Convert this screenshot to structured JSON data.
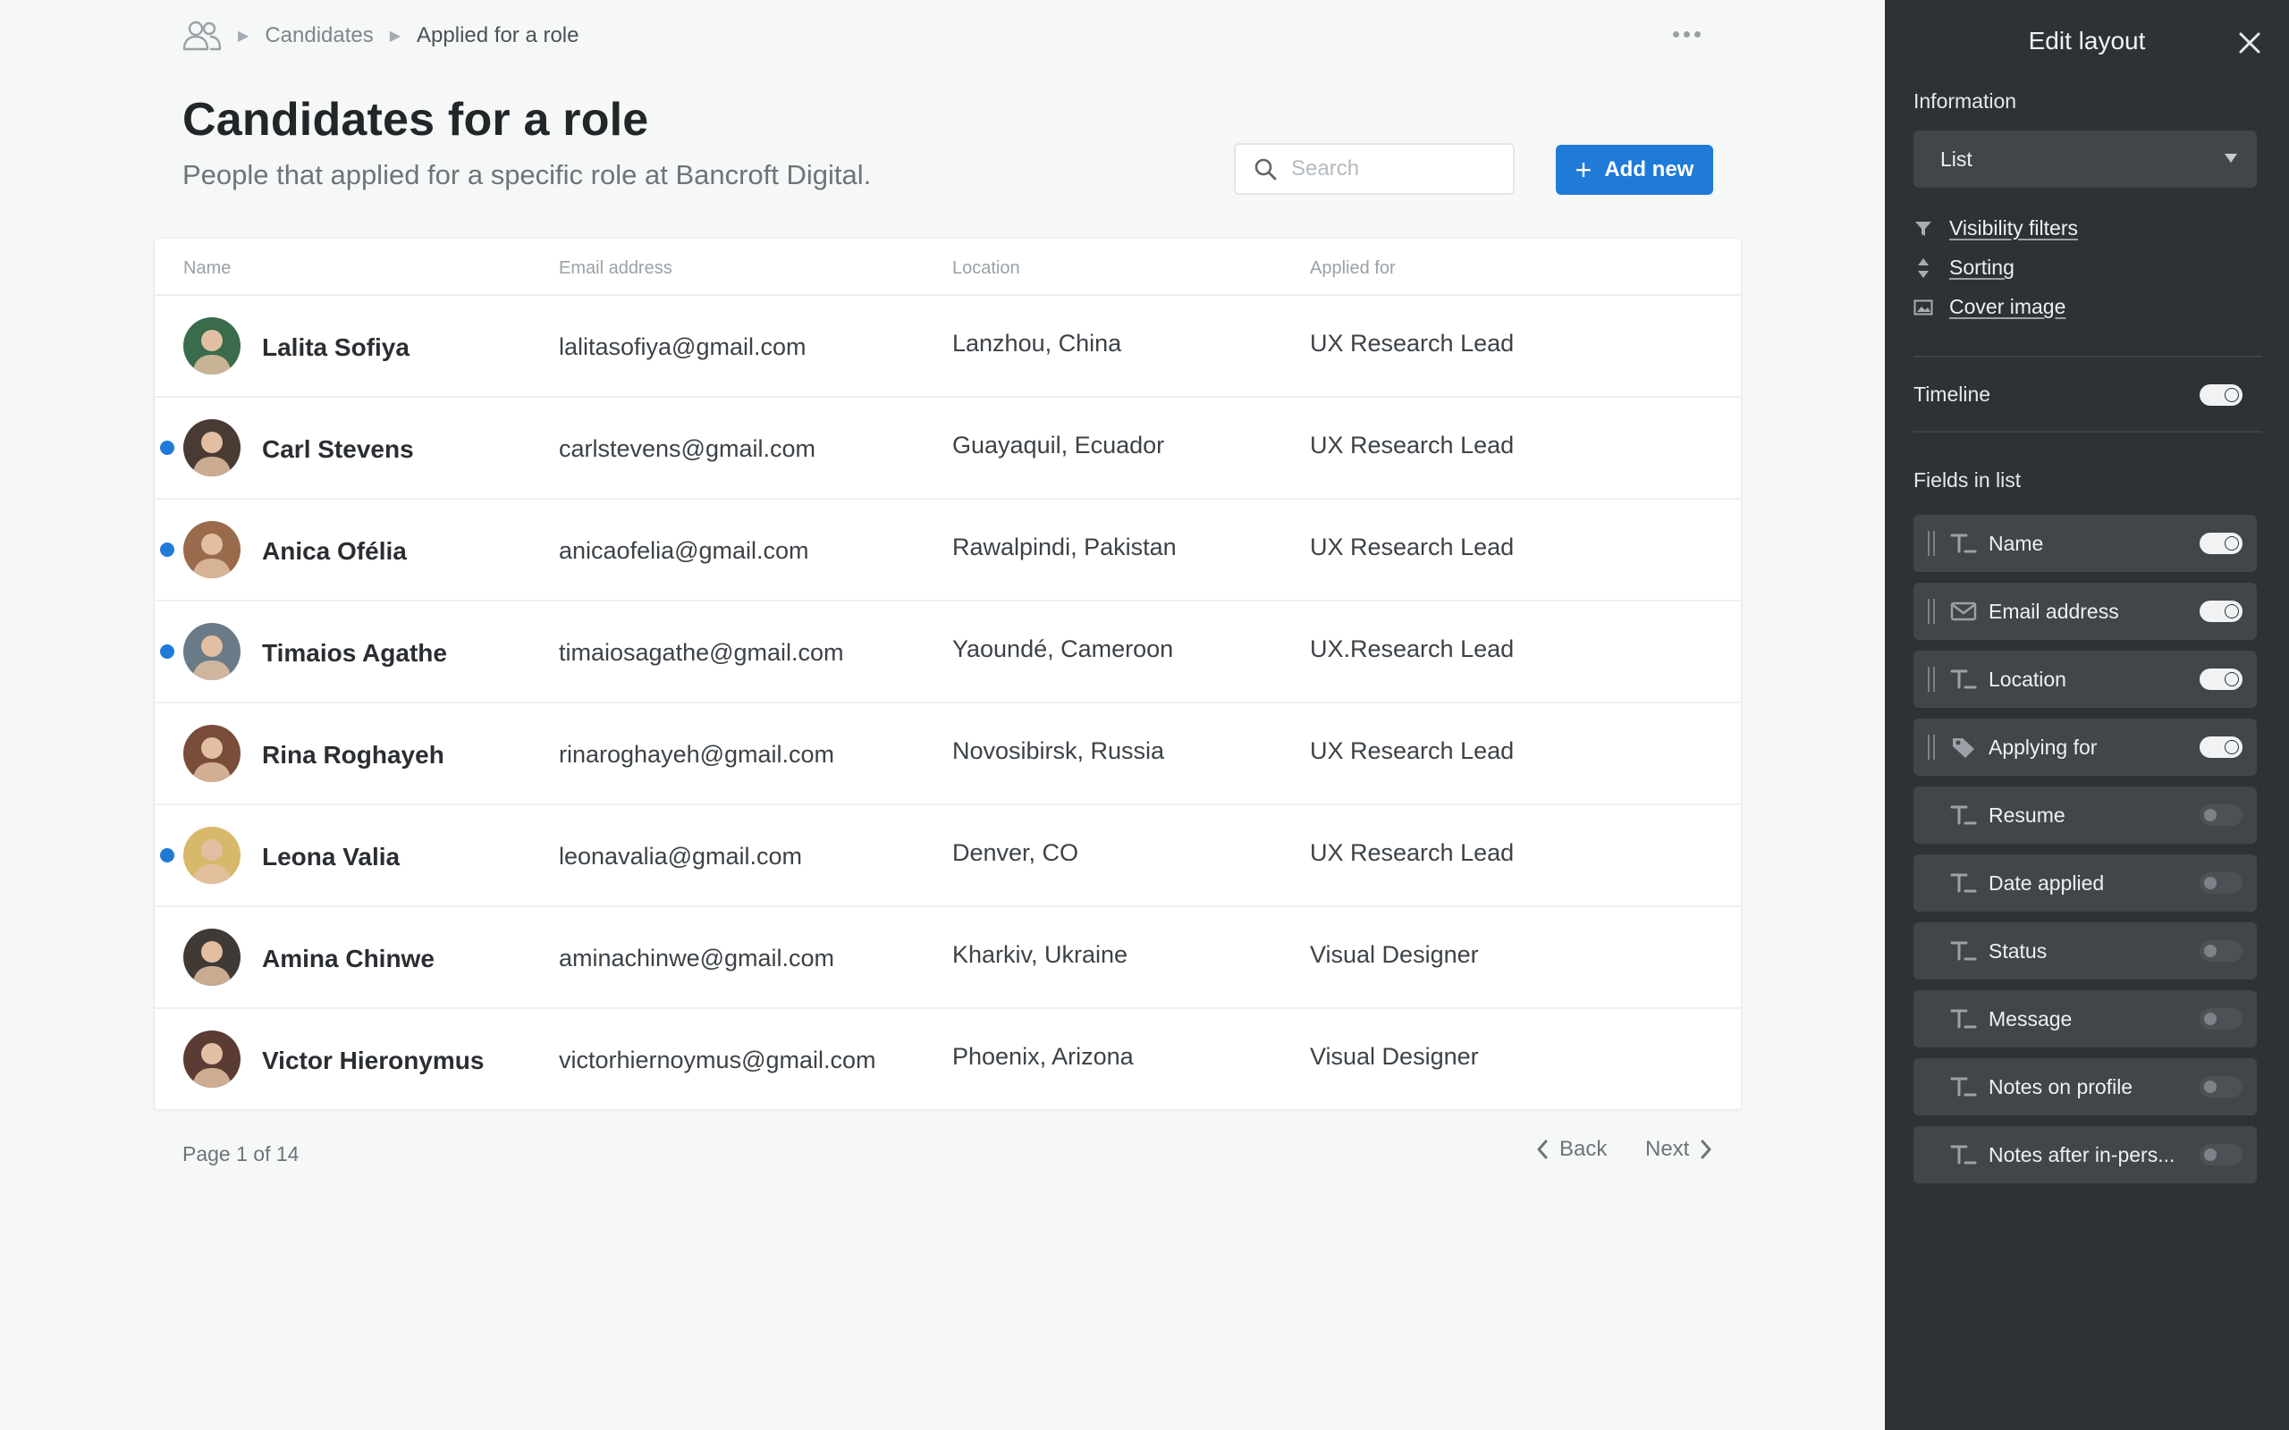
{
  "breadcrumb": {
    "root": "Candidates",
    "current": "Applied for a role"
  },
  "page": {
    "title": "Candidates for a role",
    "subtitle": "People that applied for a specific role at Bancroft Digital."
  },
  "search": {
    "placeholder": "Search",
    "value": ""
  },
  "actions": {
    "add_new": "Add new"
  },
  "table": {
    "headers": {
      "name": "Name",
      "email": "Email address",
      "location": "Location",
      "applied_for": "Applied for"
    },
    "rows": [
      {
        "name": "Lalita Sofiya",
        "email": "lalitasofiya@gmail.com",
        "location": "Lanzhou, China",
        "applied_for": "UX Research Lead",
        "unread": false,
        "avatar_color": "#3a6b4a"
      },
      {
        "name": "Carl Stevens",
        "email": "carlstevens@gmail.com",
        "location": "Guayaquil, Ecuador",
        "applied_for": "UX Research Lead",
        "unread": true,
        "avatar_color": "#4a3a34"
      },
      {
        "name": "Anica Ofélia",
        "email": "anicaofelia@gmail.com",
        "location": "Rawalpindi, Pakistan",
        "applied_for": "UX Research Lead",
        "unread": true,
        "avatar_color": "#9a6a4c"
      },
      {
        "name": "Timaios Agathe",
        "email": "timaiosagathe@gmail.com",
        "location": "Yaoundé, Cameroon",
        "applied_for": "UX.Research Lead",
        "unread": true,
        "avatar_color": "#6a7a86"
      },
      {
        "name": "Rina Roghayeh",
        "email": "rinaroghayeh@gmail.com",
        "location": "Novosibirsk, Russia",
        "applied_for": "UX Research Lead",
        "unread": false,
        "avatar_color": "#7a4c3a"
      },
      {
        "name": "Leona Valia",
        "email": "leonavalia@gmail.com",
        "location": "Denver, CO",
        "applied_for": "UX Research Lead",
        "unread": true,
        "avatar_color": "#d8b86a"
      },
      {
        "name": "Amina Chinwe",
        "email": "aminachinwe@gmail.com",
        "location": "Kharkiv, Ukraine",
        "applied_for": "Visual Designer",
        "unread": false,
        "avatar_color": "#3f3a36"
      },
      {
        "name": "Victor Hieronymus",
        "email": "victorhiernoymus@gmail.com",
        "location": "Phoenix, Arizona",
        "applied_for": "Visual Designer",
        "unread": false,
        "avatar_color": "#5a3c34"
      }
    ]
  },
  "pagination": {
    "label": "Page 1 of 14",
    "back": "Back",
    "next": "Next"
  },
  "panel": {
    "title": "Edit layout",
    "information_label": "Information",
    "layout_select": "List",
    "links": {
      "visibility": "Visibility filters",
      "sorting": "Sorting",
      "cover": "Cover image"
    },
    "timeline_label": "Timeline",
    "timeline_on": true,
    "fields_label": "Fields in list",
    "fields": [
      {
        "label": "Name",
        "icon": "text-field-icon",
        "on": true,
        "draggable": true
      },
      {
        "label": "Email address",
        "icon": "envelope-icon",
        "on": true,
        "draggable": true
      },
      {
        "label": "Location",
        "icon": "text-field-icon",
        "on": true,
        "draggable": true
      },
      {
        "label": "Applying for",
        "icon": "tag-icon",
        "on": true,
        "draggable": true
      },
      {
        "label": "Resume",
        "icon": "text-field-icon",
        "on": false,
        "draggable": false
      },
      {
        "label": "Date applied",
        "icon": "text-field-icon",
        "on": false,
        "draggable": false
      },
      {
        "label": "Status",
        "icon": "text-field-icon",
        "on": false,
        "draggable": false
      },
      {
        "label": "Message",
        "icon": "text-field-icon",
        "on": false,
        "draggable": false
      },
      {
        "label": "Notes on profile",
        "icon": "text-field-icon",
        "on": false,
        "draggable": false
      },
      {
        "label": "Notes after in-pers...",
        "icon": "text-field-icon",
        "on": false,
        "draggable": false
      }
    ]
  },
  "colors": {
    "accent": "#1f7ad8",
    "panel_bg": "#2e3236",
    "field_bg": "#41464b"
  }
}
